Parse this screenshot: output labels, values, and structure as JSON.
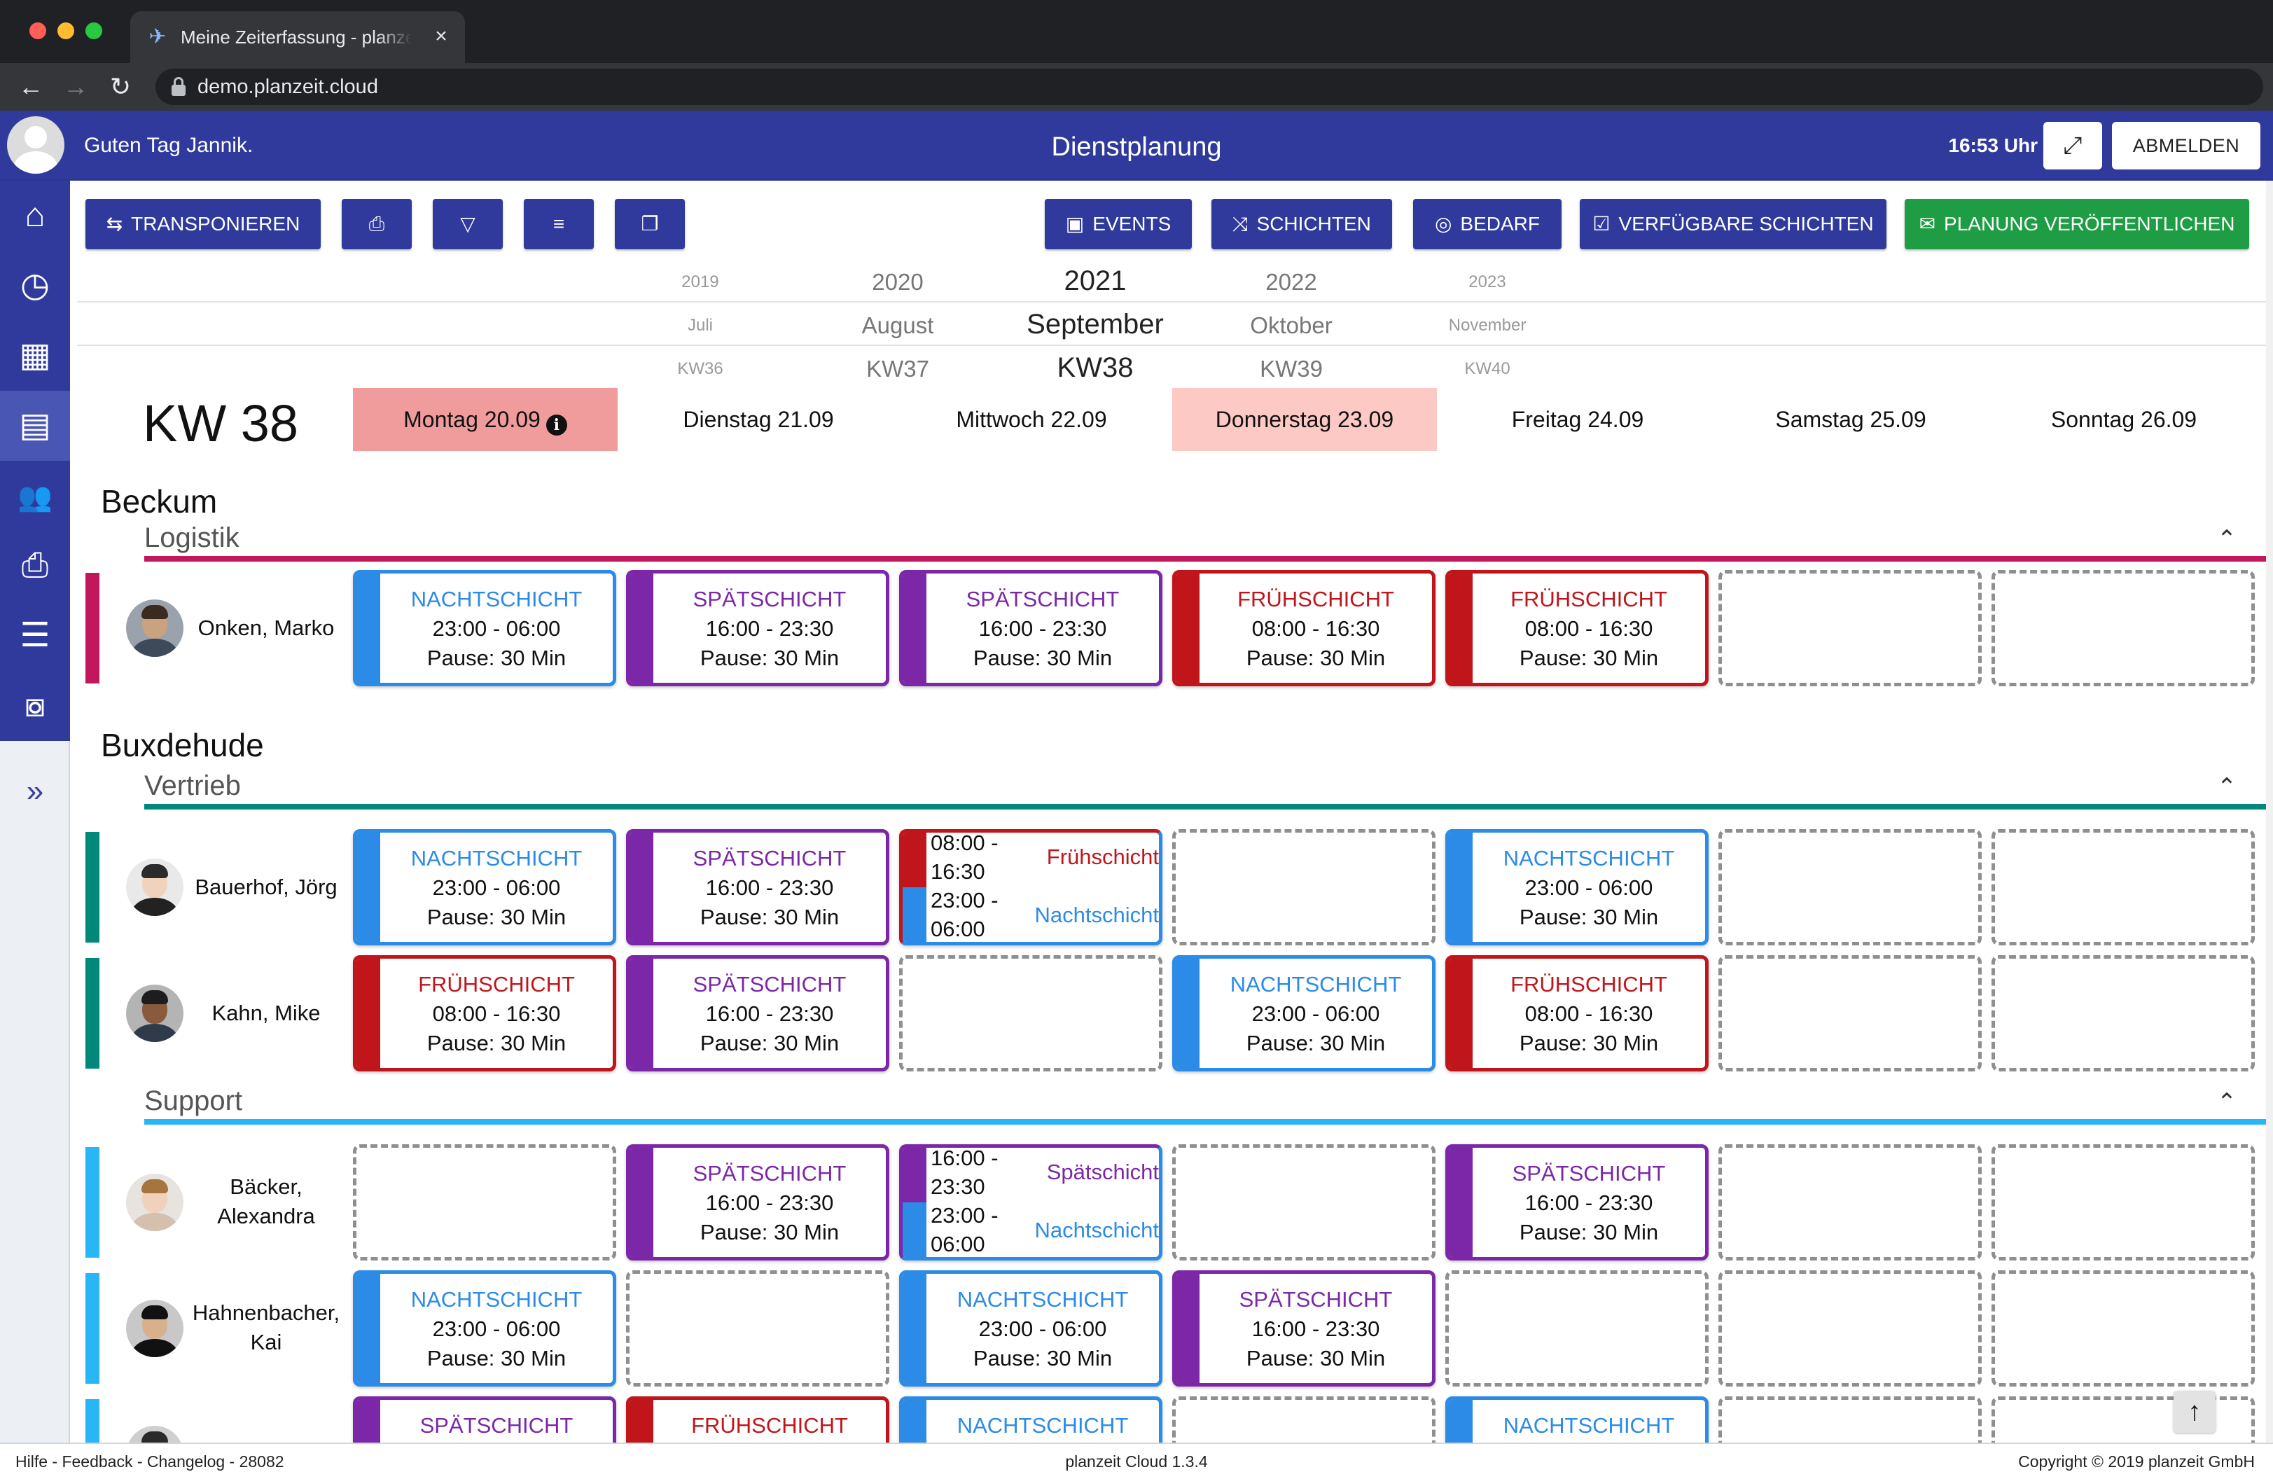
{
  "browser": {
    "tab_title": "Meine Zeiterfassung - planzeit",
    "url": "demo.planzeit.cloud",
    "colors": {
      "close": "#ff5f57",
      "minimize": "#febc2e",
      "zoom": "#28c840"
    }
  },
  "header": {
    "greeting": "Guten Tag Jannik.",
    "title": "Dienstplanung",
    "clock": "16:53 Uhr",
    "fullscreen_icon": "expand-icon",
    "logout_label": "ABMELDEN",
    "color": "#2f3a9c"
  },
  "sidebar": {
    "items": [
      {
        "icon": "home-icon",
        "glyph": "⌂"
      },
      {
        "icon": "clock-icon",
        "glyph": "◷"
      },
      {
        "icon": "calendar-icon",
        "glyph": "▦"
      },
      {
        "icon": "planning-icon",
        "glyph": "▤"
      },
      {
        "icon": "users-icon",
        "glyph": "👥"
      },
      {
        "icon": "printer-icon",
        "glyph": "⎙"
      },
      {
        "icon": "sliders-icon",
        "glyph": "☰"
      },
      {
        "icon": "time-clock-icon",
        "glyph": "⧇"
      }
    ],
    "expand_glyph": "»"
  },
  "toolbar": {
    "transpose_label": "TRANSPONIEREN",
    "events_label": "EVENTS",
    "shifts_label": "SCHICHTEN",
    "demand_label": "BEDARF",
    "available_label": "VERFÜGBARE SCHICHTEN",
    "publish_label": "PLANUNG VERÖFFENTLICHEN",
    "publish_color": "#1f9d44"
  },
  "wheel": {
    "years": [
      "2019",
      "2020",
      "2021",
      "2022",
      "2023"
    ],
    "months": [
      "Juli",
      "August",
      "September",
      "Oktober",
      "November"
    ],
    "weeks": [
      "KW36",
      "KW37",
      "KW38",
      "KW39",
      "KW40"
    ]
  },
  "week": {
    "title": "KW 38",
    "days": [
      "Montag 20.09",
      "Dienstag 21.09",
      "Mittwoch 22.09",
      "Donnerstag 23.09",
      "Freitag 24.09",
      "Samstag 25.09",
      "Sonntag 26.09"
    ],
    "info_glyph": "i"
  },
  "shift_types": {
    "nacht": {
      "name": "NACHTSCHICHT",
      "time": "23:00 - 06:00",
      "color": "#2c8be6"
    },
    "spaet": {
      "name": "SPÄTSCHICHT",
      "time": "16:00 - 23:30",
      "color": "#7b27a8"
    },
    "frueh": {
      "name": "FRÜHSCHICHT",
      "time": "08:00 - 16:30",
      "color": "#c0161b"
    },
    "pause": "Pause: 30 Min"
  },
  "locations": {
    "beckum": {
      "name": "Beckum",
      "dept": "Logistik",
      "dept_color": "#c2185b",
      "employees": [
        {
          "name": "Onken, Marko",
          "shifts": [
            "nacht",
            "spaet",
            "spaet",
            "frueh",
            "frueh",
            "",
            ""
          ]
        }
      ]
    },
    "buxdehude": {
      "name": "Buxdehude",
      "dept": "Vertrieb",
      "dept_color": "#00897b",
      "employees": [
        {
          "name": "Bauerhof, Jörg",
          "shifts": [
            "nacht",
            "spaet",
            "split",
            "",
            "nacht",
            "",
            ""
          ],
          "split": {
            "top_times": [
              "08:00 -",
              "16:30"
            ],
            "top_name": "Frühschicht",
            "bottom_times": [
              "23:00 -",
              "06:00"
            ],
            "bottom_name": "Nachtschicht"
          }
        },
        {
          "name": "Kahn, Mike",
          "shifts": [
            "frueh",
            "spaet",
            "",
            "nacht",
            "frueh",
            "",
            ""
          ]
        }
      ]
    },
    "support": {
      "dept": "Support",
      "dept_color": "#29b6f6",
      "employees": [
        {
          "name_lines": [
            "Bäcker,",
            "Alexandra"
          ],
          "shifts": [
            "",
            "spaet",
            "split",
            "",
            "spaet",
            "",
            ""
          ],
          "split": {
            "top_times": [
              "16:00 -",
              "23:30"
            ],
            "top_name": "Spätschicht",
            "bottom_times": [
              "23:00 -",
              "06:00"
            ],
            "bottom_name": "Nachtschicht"
          }
        },
        {
          "name_lines": [
            "Hahnenbacher,",
            "Kai"
          ],
          "shifts": [
            "nacht",
            "",
            "nacht",
            "spaet",
            "",
            "",
            ""
          ]
        },
        {
          "name_lines": [
            "",
            ""
          ],
          "shifts": [
            "spaet",
            "frueh",
            "nacht",
            "",
            "nacht",
            "",
            ""
          ]
        }
      ]
    }
  },
  "footer": {
    "left": "Hilfe - Feedback - Changelog - 28082",
    "center": "planzeit Cloud 1.3.4",
    "right": "Copyright © 2019 planzeit GmbH"
  }
}
